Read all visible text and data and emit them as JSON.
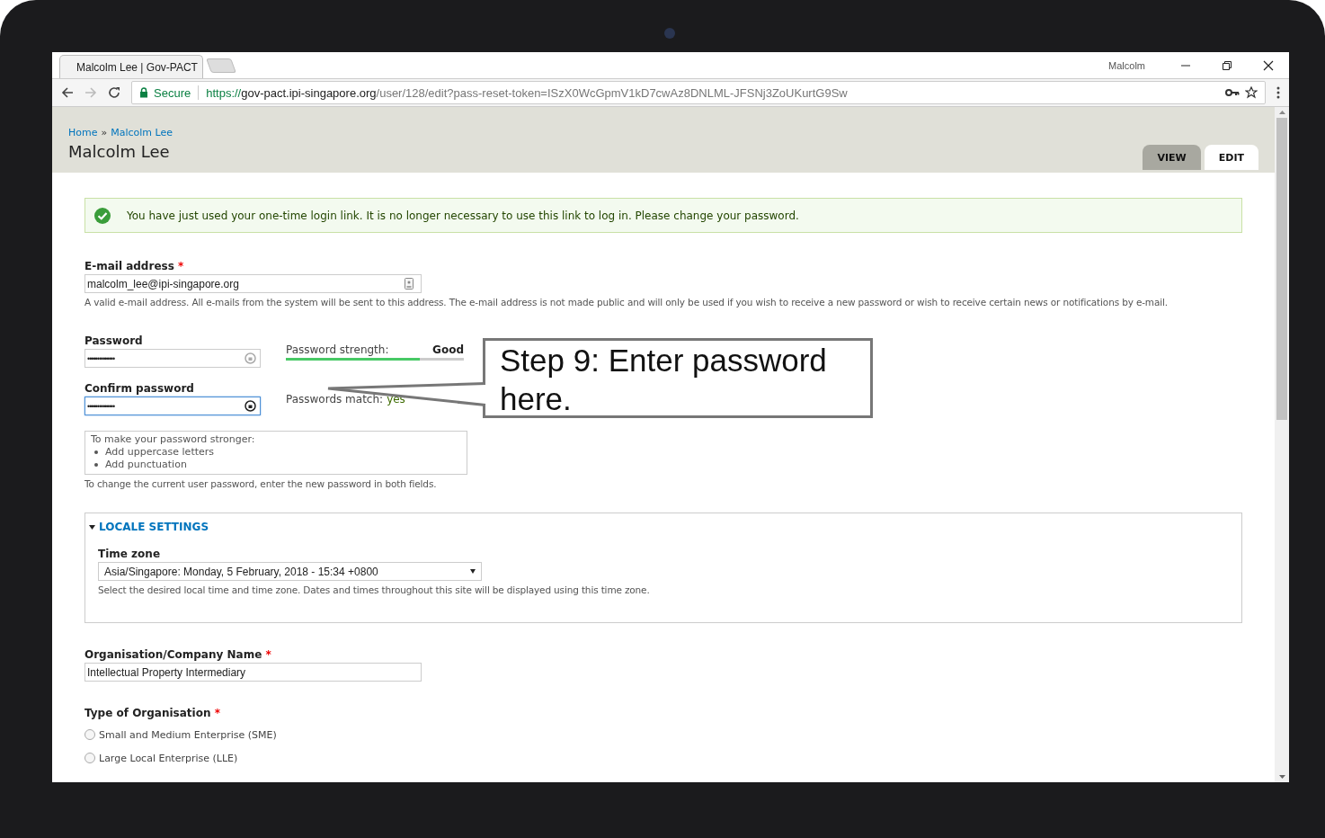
{
  "browser": {
    "tab_title": "Malcolm Lee | Gov-PACT",
    "profile": "Malcolm",
    "secure_label": "Secure",
    "url_scheme": "https://",
    "url_host": "gov-pact.ipi-singapore.org",
    "url_path": "/user/128/edit?pass-reset-token=ISzX0WcGpmV1kD7cwAz8DNLML-JFSNj3ZoUKurtG9Sw"
  },
  "breadcrumb": {
    "items": [
      "Home",
      "Malcolm Lee"
    ],
    "separator": "»"
  },
  "page_title": "Malcolm Lee",
  "tabs": [
    {
      "label": "VIEW",
      "selected": false
    },
    {
      "label": "EDIT",
      "selected": true
    }
  ],
  "status_message": "You have just used your one-time login link. It is no longer necessary to use this link to log in. Please change your password.",
  "email": {
    "label": "E-mail address",
    "required_marker": "*",
    "value": "malcolm_lee@ipi-singapore.org",
    "description": "A valid e-mail address. All e-mails from the system will be sent to this address. The e-mail address is not made public and will only be used if you wish to receive a new password or wish to receive certain news or notifications by e-mail."
  },
  "password": {
    "label": "Password",
    "value": "••••••••••••••",
    "focused": false,
    "strength_label": "Password strength:",
    "strength_value": "Good",
    "level": 0.75
  },
  "confirm_password": {
    "label": "Confirm password",
    "value": "••••••••••••••",
    "focused": true,
    "match_label": "Passwords match:",
    "match_value": "yes"
  },
  "suggestions": {
    "title": "To make your password stronger:",
    "items": [
      "Add uppercase letters",
      "Add punctuation"
    ]
  },
  "password_description": "To change the current user password, enter the new password in both fields.",
  "locale": {
    "legend": "LOCALE SETTINGS",
    "expanded": true,
    "timezone_label": "Time zone",
    "timezone_value": "Asia/Singapore: Monday, 5 February, 2018 - 15:34 +0800",
    "description": "Select the desired local time and time zone. Dates and times throughout this site will be displayed using this time zone."
  },
  "organisation": {
    "label": "Organisation/Company Name",
    "required_marker": "*",
    "value": "Intellectual Property Intermediary"
  },
  "organisation_type": {
    "label": "Type of Organisation",
    "required_marker": "*",
    "options": [
      {
        "label": "Small and Medium Enterprise (SME)",
        "selected": false
      },
      {
        "label": "Large Local Enterprise (LLE)",
        "selected": false
      }
    ]
  },
  "callout": {
    "text": "Step 9: Enter password here."
  }
}
